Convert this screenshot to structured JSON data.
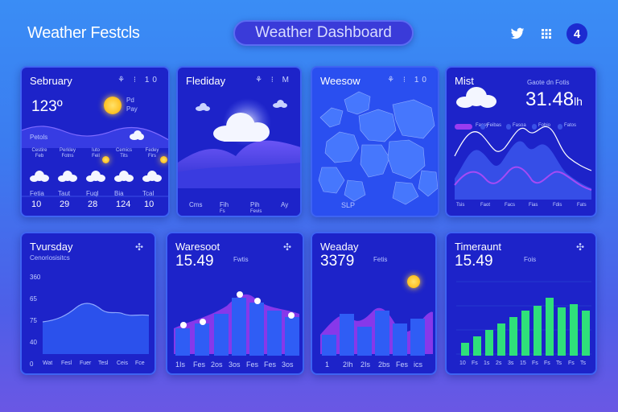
{
  "header": {
    "brand": "Weather Festcls",
    "title": "Weather Dashboard",
    "icons": [
      "twitter-icon",
      "grid-icon"
    ],
    "badge": "4"
  },
  "cards": {
    "c1": {
      "title": "Sebruary",
      "icons": "⚘ ⁝ 10",
      "temp": "123º",
      "sub1": "Pd",
      "sub2": "Pay",
      "left_label": "Petols",
      "forecast": [
        {
          "t1": "Cestire",
          "t2": "Feb",
          "n": "10"
        },
        {
          "t1": "Perkley",
          "t2": "Fotns",
          "n": "29"
        },
        {
          "t1": "Iuto",
          "t2": "Feil",
          "n": "28"
        },
        {
          "t1": "Cemics",
          "t2": "Tits",
          "n": "124"
        },
        {
          "t1": "Fedey",
          "t2": "Firs",
          "n": "10"
        }
      ],
      "low_labels": [
        "Fetia",
        "Taut",
        "Fuql",
        "Bia",
        "Tcal"
      ]
    },
    "c2": {
      "title": "Flediday",
      "icons": "⚘ ⁝ M",
      "ticks": [
        "Cms",
        "Fih",
        "Pih",
        "Ay"
      ],
      "ticks2": [
        "",
        "Fs",
        "Fevis",
        ""
      ]
    },
    "c3": {
      "title": "Weesow",
      "icons": "⚘ ⁝ 10",
      "footer": "SLP"
    },
    "c4": {
      "title": "Mist",
      "value": "31.48",
      "unit": "lh",
      "sub": "Gaote dn Fotis",
      "legend": [
        "Fassy",
        "Feibas",
        "Fasoa",
        "Fobio",
        "Fatos"
      ],
      "ticks": [
        "Tsis",
        "Faot",
        "Facs",
        "Fias",
        "Fdis",
        "Fats"
      ]
    },
    "c5": {
      "title": "Tvursday",
      "subtitle": "Cenoriosisitcs",
      "yticks": [
        "360",
        "65",
        "75",
        "40",
        "0"
      ],
      "xticks": [
        "Wat",
        "Fesl",
        "Fuer",
        "Tesl",
        "Ceis",
        "Fce"
      ]
    },
    "c6": {
      "title": "Waresoot",
      "value": "15.49",
      "sub": "Fwtis",
      "xticks": [
        "1Is",
        "Fes",
        "2os",
        "3os",
        "Fes",
        "Fes",
        "3os"
      ]
    },
    "c7": {
      "title": "Weaday",
      "value": "3379",
      "sub": "Fetis",
      "xticks": [
        "1",
        "2Ih",
        "2Is",
        "2bs",
        "Fes",
        "ics"
      ]
    },
    "c8": {
      "title": "Timeraunt",
      "value": "15.49",
      "sub": "Fois",
      "xticks": [
        "10",
        "Fs",
        "1s",
        "2s",
        "3s",
        "15",
        "Fs",
        "Fs",
        "Ts",
        "Fs",
        "Ts"
      ]
    }
  },
  "colors": {
    "card": "#1d23c9",
    "accent_purple": "#9a3cf0",
    "bar_blue": "#2f5df5",
    "bar_green": "#2fe07a",
    "sun": "#ffc21f"
  }
}
